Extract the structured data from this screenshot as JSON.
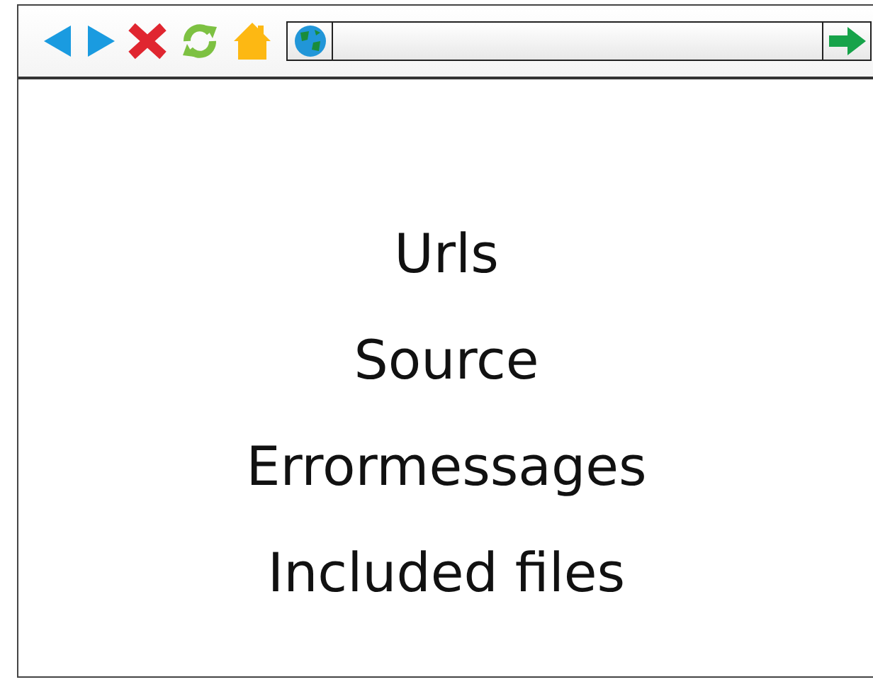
{
  "items": [
    "Urls",
    "Source",
    "Errormessages",
    "Included files"
  ]
}
